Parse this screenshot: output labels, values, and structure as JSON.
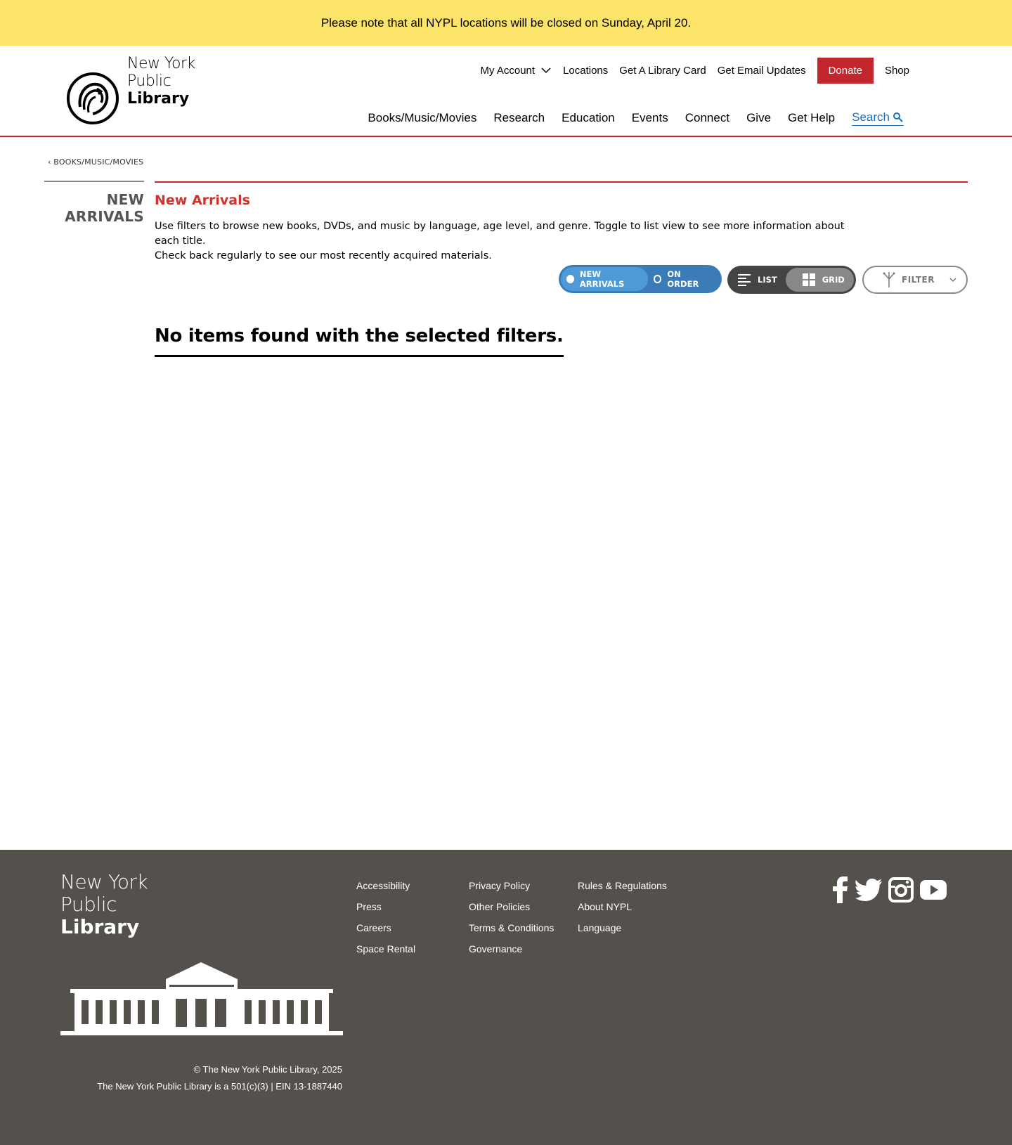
{
  "alert": {
    "text": "Please note that all NYPL locations will be closed on Sunday, April 20."
  },
  "logo": {
    "line1": "New York",
    "line2": "Public",
    "line3": "Library"
  },
  "utility_nav": {
    "my_account": "My Account",
    "locations": "Locations",
    "library_card": "Get A Library Card",
    "email_updates": "Get Email Updates",
    "donate": "Donate",
    "shop": "Shop"
  },
  "main_nav": {
    "items": [
      "Books/Music/Movies",
      "Research",
      "Education",
      "Events",
      "Connect",
      "Give",
      "Get Help"
    ],
    "search": "Search"
  },
  "breadcrumb": {
    "label": "‹ BOOKS/MUSIC/MOVIES"
  },
  "sidebar": {
    "title_line1": "NEW",
    "title_line2": "ARRIVALS"
  },
  "page": {
    "title": "New Arrivals",
    "intro_line1": "Use filters to browse new books, DVDs, and music by language, age level, and genre. Toggle to list view to see more information about each title.",
    "intro_line2": "Check back regularly to see our most recently acquired materials.",
    "empty_message": "No items found with the selected filters."
  },
  "controls": {
    "type_toggle": {
      "new_arrivals": "NEW ARRIVALS",
      "on_order": "ON ORDER",
      "selected": "new_arrivals"
    },
    "view_toggle": {
      "list": "LIST",
      "grid": "GRID",
      "selected": "grid"
    },
    "filter": "FILTER"
  },
  "footer": {
    "logo": {
      "line1": "New York",
      "line2": "Public",
      "line3": "Library"
    },
    "col1": [
      "Accessibility",
      "Press",
      "Careers",
      "Space Rental"
    ],
    "col2": [
      "Privacy Policy",
      "Other Policies",
      "Terms & Conditions",
      "Governance"
    ],
    "col3": [
      "Rules & Regulations",
      "About NYPL",
      "Language"
    ],
    "copyright": "© The New York Public Library, 2025",
    "ein": "The New York Public Library is a 501(c)(3) | EIN 13-1887440",
    "social": [
      "facebook-icon",
      "twitter-icon",
      "instagram-icon",
      "youtube-icon"
    ]
  },
  "colors": {
    "alert_bg": "#fce46b",
    "brand_red": "#c1272d",
    "link_blue": "#1a6fc1",
    "toggle_blue": "#3b7cb8",
    "footer_bg": "#54514d"
  }
}
